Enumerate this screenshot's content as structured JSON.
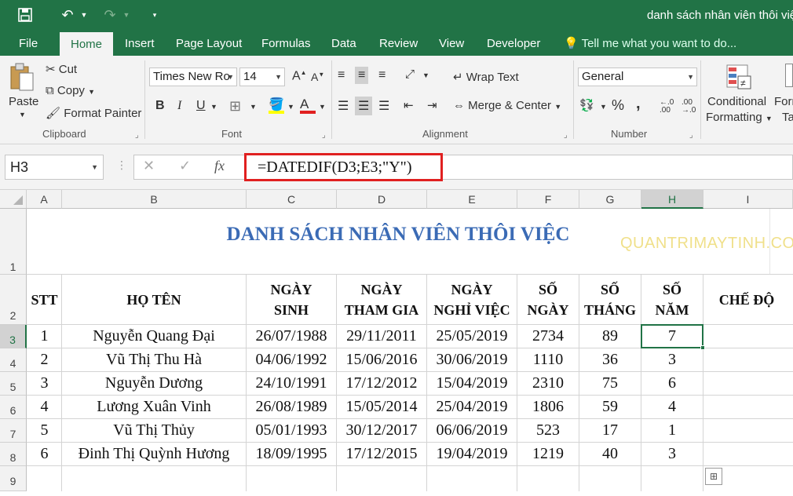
{
  "titlebar": {
    "doc_title": "danh sách nhân viên thôi việ",
    "icons": [
      "save-icon",
      "undo-icon",
      "redo-icon",
      "customize-qat-icon"
    ]
  },
  "tabs": [
    "File",
    "Home",
    "Insert",
    "Page Layout",
    "Formulas",
    "Data",
    "Review",
    "View",
    "Developer"
  ],
  "tell_me": "Tell me what you want to do...",
  "ribbon": {
    "clipboard": {
      "paste": "Paste",
      "cut": "Cut",
      "copy": "Copy",
      "format_painter": "Format Painter",
      "label": "Clipboard"
    },
    "font": {
      "name": "Times New Ro",
      "size": "14",
      "bold": "B",
      "italic": "I",
      "underline": "U",
      "label": "Font"
    },
    "alignment": {
      "wrap": "Wrap Text",
      "merge": "Merge & Center",
      "label": "Alignment"
    },
    "number": {
      "format": "General",
      "percent": "%",
      "comma": ",",
      "label": "Number"
    },
    "styles": {
      "conditional_1": "Conditional",
      "conditional_2": "Formatting",
      "format_as_1": "Form",
      "format_as_2": "Ta"
    }
  },
  "formula_bar": {
    "name_box": "H3",
    "formula": "=DATEDIF(D3;E3;\"Y\")",
    "fx": "fx"
  },
  "columns": [
    "A",
    "B",
    "C",
    "D",
    "E",
    "F",
    "G",
    "H",
    "I"
  ],
  "rows": [
    "1",
    "2",
    "3",
    "4",
    "5",
    "6",
    "7",
    "8",
    "9"
  ],
  "sheet": {
    "title": "DANH SÁCH NHÂN VIÊN THÔI VIỆC",
    "watermark": "QUANTRIMAYTINH.COM",
    "headers": {
      "stt": "STT",
      "hoten": "HỌ TÊN",
      "ngaysinh_1": "NGÀY",
      "ngaysinh_2": "SINH",
      "thamgia_1": "NGÀY",
      "thamgia_2": "THAM GIA",
      "nghiviec_1": "NGÀY",
      "nghiviec_2": "NGHỈ VIỆC",
      "songay_1": "SỐ",
      "songay_2": "NGÀY",
      "sothang_1": "SỐ",
      "sothang_2": "THÁNG",
      "sonam_1": "SỐ",
      "sonam_2": "NĂM",
      "chedo": "CHẾ ĐỘ"
    },
    "rows": [
      {
        "stt": "1",
        "name": "Nguyễn Quang Đại",
        "dob": "26/07/1988",
        "join": "29/11/2011",
        "leave": "25/05/2019",
        "days": "2734",
        "months": "89",
        "years": "7"
      },
      {
        "stt": "2",
        "name": "Vũ Thị Thu Hà",
        "dob": "04/06/1992",
        "join": "15/06/2016",
        "leave": "30/06/2019",
        "days": "1110",
        "months": "36",
        "years": "3"
      },
      {
        "stt": "3",
        "name": "Nguyễn Dương",
        "dob": "24/10/1991",
        "join": "17/12/2012",
        "leave": "15/04/2019",
        "days": "2310",
        "months": "75",
        "years": "6"
      },
      {
        "stt": "4",
        "name": "Lương Xuân Vinh",
        "dob": "26/08/1989",
        "join": "15/05/2014",
        "leave": "25/04/2019",
        "days": "1806",
        "months": "59",
        "years": "4"
      },
      {
        "stt": "5",
        "name": "Vũ Thị Thủy",
        "dob": "05/01/1993",
        "join": "30/12/2017",
        "leave": "06/06/2019",
        "days": "523",
        "months": "17",
        "years": "1"
      },
      {
        "stt": "6",
        "name": "Đinh Thị Quỳnh Hương",
        "dob": "18/09/1995",
        "join": "17/12/2015",
        "leave": "19/04/2019",
        "days": "1219",
        "months": "40",
        "years": "3"
      }
    ]
  },
  "colors": {
    "excel_green": "#217346",
    "title_blue": "#3b6bb5",
    "highlight_red": "#e02020"
  }
}
